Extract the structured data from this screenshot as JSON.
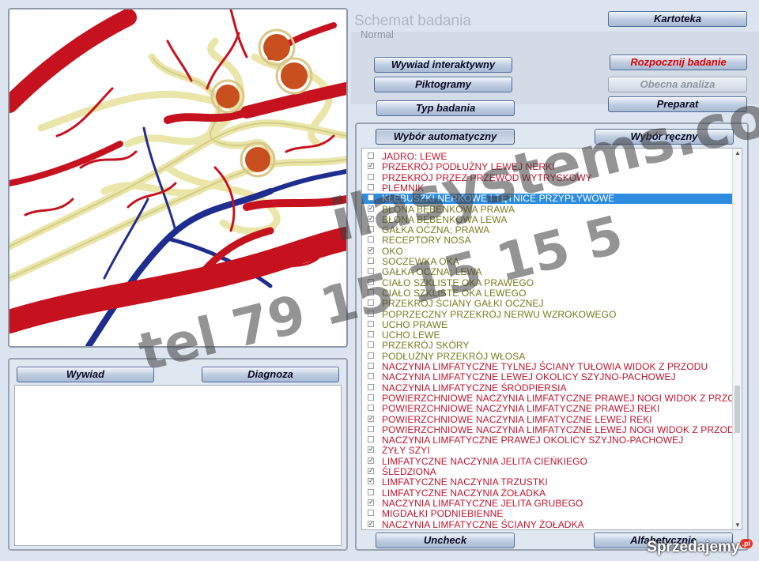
{
  "schema": {
    "title": "Schemat badania",
    "mode": "Normal"
  },
  "buttons": {
    "kartoteka": "Kartoteka",
    "rozpocznij": "Rozpocznij badanie",
    "wywiad_interaktywny": "Wywiad interaktywny",
    "piktogramy": "Piktogramy",
    "obecna_analiza": "Obecna analiza",
    "typ_badania": "Typ badania",
    "preparat": "Preparat",
    "wybor_auto": "Wybór automatyczny",
    "wybor_reczny": "Wybór ręczny",
    "wywiad": "Wywiad",
    "diagnoza": "Diagnoza",
    "uncheck": "Uncheck",
    "alfabetycznie": "Alfabetycznie"
  },
  "colors": {
    "accent_red": "#e00000",
    "selection": "#2d8be0",
    "item_red": "#c0142e",
    "item_olive": "#7c7a1e"
  },
  "list": {
    "items": [
      {
        "label": "JADRO:  LEWE",
        "checked": false,
        "color": "red"
      },
      {
        "label": "PRZEKRÓJ PODŁUŻNY LEWEJ NERKI",
        "checked": true,
        "color": "red"
      },
      {
        "label": "PRZEKRÓJ PRZEZ PRZEWÓD WYTRYSKOWY",
        "checked": false,
        "color": "red"
      },
      {
        "label": "PLEMNIK",
        "checked": false,
        "color": "red"
      },
      {
        "label": "KŁĘBUSZKI NERKOWE I TĘTNICE PRZYPŁYWOWE",
        "checked": false,
        "color": "selected"
      },
      {
        "label": "BŁONA BĘBENKOWA PRAWA",
        "checked": true,
        "color": "olive"
      },
      {
        "label": "BŁONA BĘBENKOWA LEWA",
        "checked": true,
        "color": "olive"
      },
      {
        "label": "GAŁKA OCZNA;  PRAWA",
        "checked": false,
        "color": "olive"
      },
      {
        "label": "RECEPTORY NOSA",
        "checked": false,
        "color": "olive"
      },
      {
        "label": "OKO",
        "checked": true,
        "color": "olive"
      },
      {
        "label": "SOCZEWKA OKA",
        "checked": false,
        "color": "olive"
      },
      {
        "label": "GAŁKA OCZNA;  LEWA",
        "checked": false,
        "color": "olive"
      },
      {
        "label": "CIAŁO SZKLISTE OKA PRAWEGO",
        "checked": false,
        "color": "olive"
      },
      {
        "label": "CIAŁO SZKLISTE OKA LEWEGO",
        "checked": false,
        "color": "olive"
      },
      {
        "label": "PRZEKRÓJ ŚCIANY GAŁKI OCZNEJ",
        "checked": false,
        "color": "olive"
      },
      {
        "label": "POPRZECZNY PRZEKRÓJ NERWU WZROKOWEGO",
        "checked": false,
        "color": "olive"
      },
      {
        "label": "UCHO PRAWE",
        "checked": false,
        "color": "olive"
      },
      {
        "label": "UCHO LEWE",
        "checked": false,
        "color": "olive"
      },
      {
        "label": "PRZEKRÓJ SKÓRY",
        "checked": false,
        "color": "olive"
      },
      {
        "label": "PODŁUŻNY  PRZEKRÓJ  WŁOSA",
        "checked": false,
        "color": "olive"
      },
      {
        "label": "NACZYNIA LIMFATYCZNE TYLNEJ ŚCIANY TUŁOWIA WIDOK Z PRZODU",
        "checked": false,
        "color": "red"
      },
      {
        "label": "NACZYNIA LIMFATYCZNE LEWEJ OKOLICY SZYJNO-PACHOWEJ",
        "checked": false,
        "color": "red"
      },
      {
        "label": "NACZYNIA LIMFATYCZNE ŚRÓDPIERSIA",
        "checked": false,
        "color": "red"
      },
      {
        "label": "POWIERZCHNIOWE NACZYNIA LIMFATYCZNE PRAWEJ NOGI WIDOK Z PRZODU",
        "checked": false,
        "color": "red"
      },
      {
        "label": "POWIERZCHNIOWE NACZYNIA LIMFATYCZNE PRAWEJ REKI",
        "checked": false,
        "color": "red"
      },
      {
        "label": "POWIERZCHNIOWE NACZYNIA LIMFATYCZNE LEWEJ REKI",
        "checked": true,
        "color": "red"
      },
      {
        "label": "POWIERZCHNIOWE NACZYNIA LIMFATYCZNE LEWEJ NOGI WIDOK Z PRZODU",
        "checked": false,
        "color": "red"
      },
      {
        "label": "NACZYNIA LIMFATYCZNE PRAWEJ OKOLICY SZYJNO-PACHOWEJ",
        "checked": false,
        "color": "red"
      },
      {
        "label": "ŻYŁY SZYI",
        "checked": true,
        "color": "red"
      },
      {
        "label": "LIMFATYCZNE NACZYNIA JELITA CIEŃKIEGO",
        "checked": true,
        "color": "red"
      },
      {
        "label": "ŚLEDZIONA",
        "checked": true,
        "color": "red"
      },
      {
        "label": "LIMFATYCZNE NACZYNIA TRZUSTKI",
        "checked": true,
        "color": "red"
      },
      {
        "label": "LIMFATYCZNE NACZYNIA ŻOŁADKA",
        "checked": false,
        "color": "red"
      },
      {
        "label": "NACZYNIA LIMFATYCZNE JELITA GRUBEGO",
        "checked": true,
        "color": "red"
      },
      {
        "label": "MIGDAŁKI PODNIEBIENNE",
        "checked": false,
        "color": "red"
      },
      {
        "label": "NACZYNIA LIMFATYCZNE ŚCIANY ŻOŁADKA",
        "checked": true,
        "color": "red"
      }
    ]
  },
  "watermark": {
    "line1": "ilasystems.com",
    "line2": "tel 79 15 15 15 5",
    "badge": "Sprzedajemy",
    "badge_tld": ".pl"
  }
}
